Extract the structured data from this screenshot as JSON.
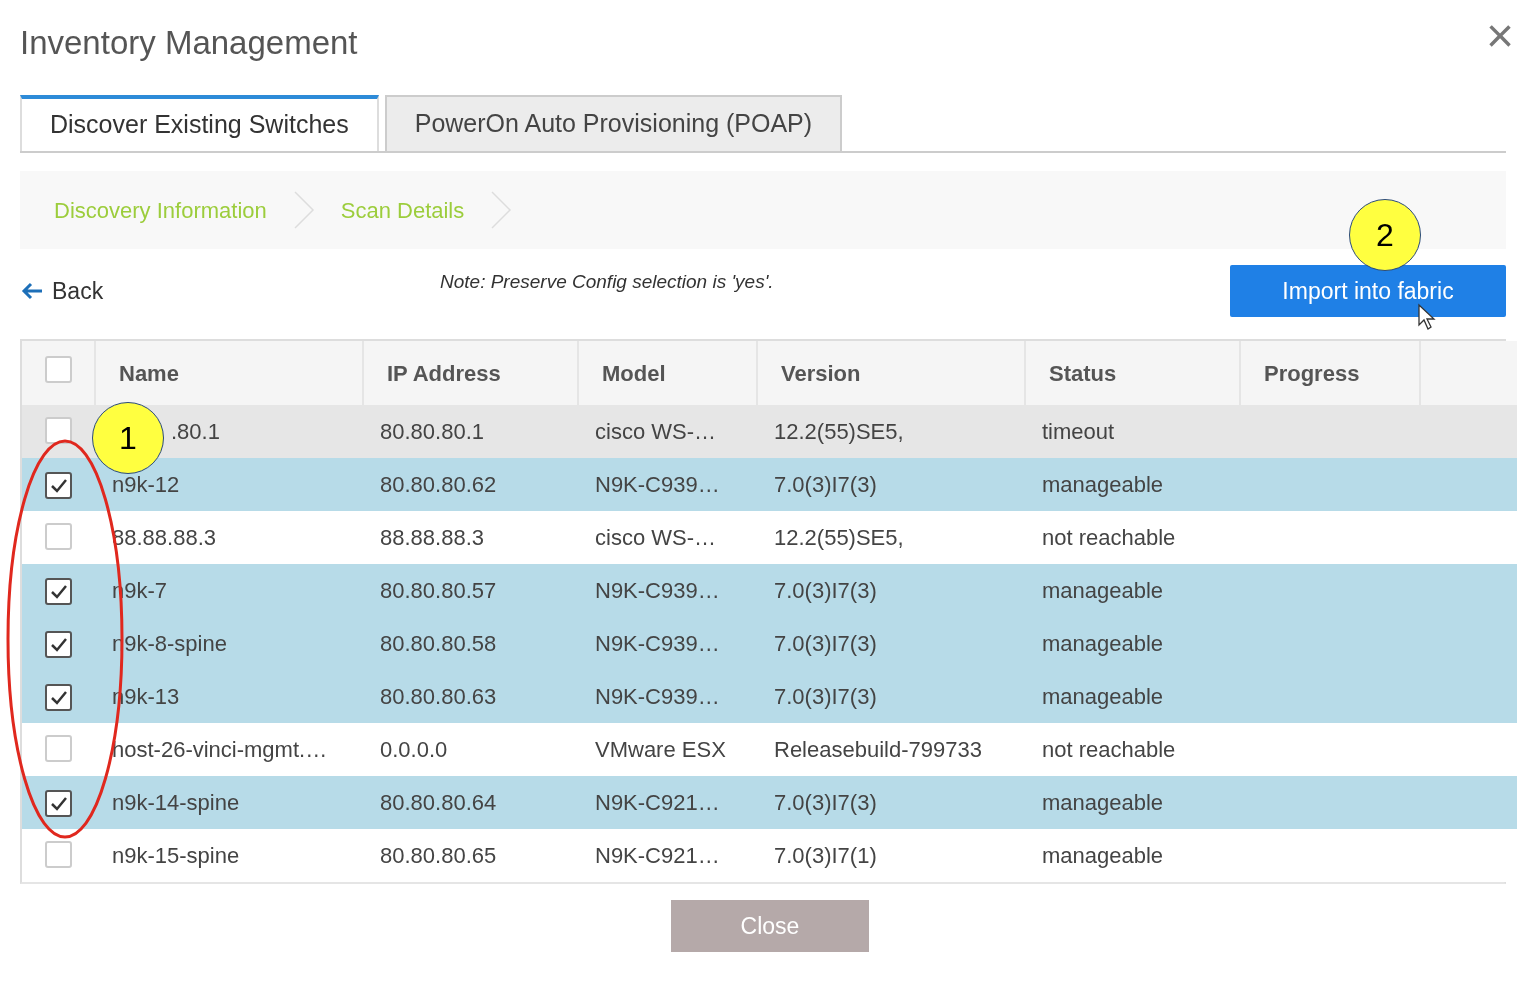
{
  "dialog": {
    "title": "Inventory Management",
    "close": "×"
  },
  "tabs": [
    {
      "label": "Discover Existing Switches",
      "selected": true
    },
    {
      "label": "PowerOn Auto Provisioning (POAP)",
      "selected": false
    }
  ],
  "steps": [
    "Discovery Information",
    "Scan Details"
  ],
  "back": "Back",
  "note": "Note: Preserve Config selection is 'yes'.",
  "import_button": "Import into fabric",
  "table": {
    "columns": [
      "Name",
      "IP Address",
      "Model",
      "Version",
      "Status",
      "Progress"
    ],
    "select_all_checked": false,
    "rows": [
      {
        "checked": false,
        "hovered": true,
        "cells": [
          ".80.1",
          "80.80.80.1",
          "cisco WS-…",
          "12.2(55)SE5,",
          "timeout"
        ]
      },
      {
        "checked": true,
        "hovered": false,
        "cells": [
          "n9k-12",
          "80.80.80.62",
          "N9K-C939…",
          "7.0(3)I7(3)",
          "manageable"
        ]
      },
      {
        "checked": false,
        "hovered": false,
        "cells": [
          "88.88.88.3",
          "88.88.88.3",
          "cisco WS-…",
          "12.2(55)SE5,",
          "not reachable"
        ]
      },
      {
        "checked": true,
        "hovered": false,
        "cells": [
          "n9k-7",
          "80.80.80.57",
          "N9K-C939…",
          "7.0(3)I7(3)",
          "manageable"
        ]
      },
      {
        "checked": true,
        "hovered": false,
        "cells": [
          "n9k-8-spine",
          "80.80.80.58",
          "N9K-C939…",
          "7.0(3)I7(3)",
          "manageable"
        ]
      },
      {
        "checked": true,
        "hovered": false,
        "cells": [
          "n9k-13",
          "80.80.80.63",
          "N9K-C939…",
          "7.0(3)I7(3)",
          "manageable"
        ]
      },
      {
        "checked": false,
        "hovered": false,
        "cells": [
          "host-26-vinci-mgmt.…",
          "0.0.0.0",
          "VMware ESX",
          "Releasebuild-799733",
          "not reachable"
        ]
      },
      {
        "checked": true,
        "hovered": false,
        "cells": [
          "n9k-14-spine",
          "80.80.80.64",
          "N9K-C921…",
          "7.0(3)I7(3)",
          "manageable"
        ]
      },
      {
        "checked": false,
        "hovered": false,
        "cells": [
          "n9k-15-spine",
          "80.80.80.65",
          "N9K-C921…",
          "7.0(3)I7(1)",
          "manageable"
        ]
      }
    ]
  },
  "close_button": {
    "label": "Close",
    "disabled": true
  },
  "callouts": [
    "1",
    "2"
  ]
}
